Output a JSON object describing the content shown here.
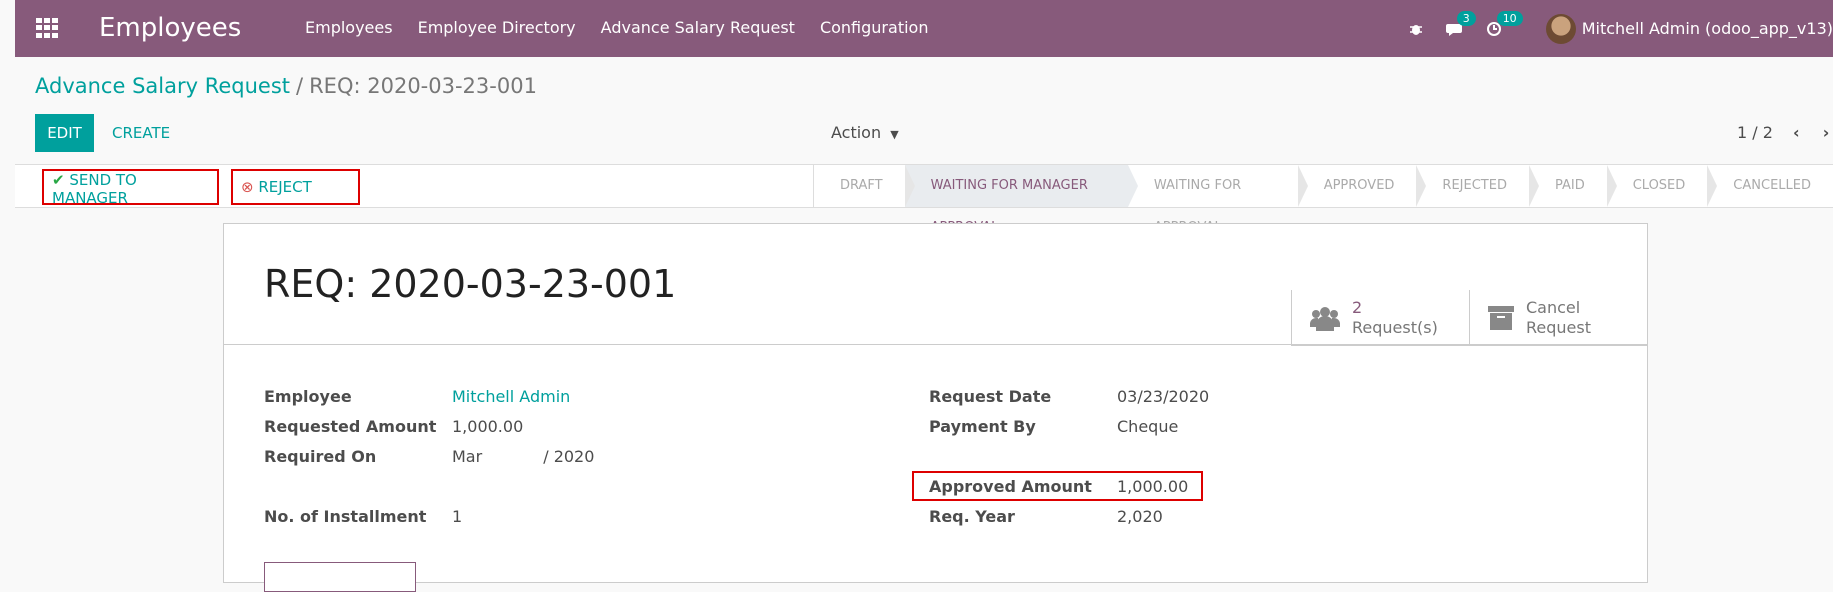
{
  "app": {
    "title": "Employees",
    "menu": [
      "Employees",
      "Employee Directory",
      "Advance Salary Request",
      "Configuration"
    ],
    "chat_badge": "3",
    "activity_badge": "10",
    "user": "Mitchell Admin (odoo_app_v13)"
  },
  "breadcrumb": {
    "parent": "Advance Salary Request",
    "separator": "/",
    "current": "REQ: 2020-03-23-001"
  },
  "control": {
    "edit": "EDIT",
    "create": "CREATE",
    "action": "Action",
    "pager": "1 / 2"
  },
  "statusbar": {
    "send_to_manager": "SEND TO MANAGER",
    "reject": "REJECT",
    "stages": [
      "DRAFT",
      "WAITING FOR MANAGER APPROVAL",
      "WAITING FOR APPROVAL",
      "APPROVED",
      "REJECTED",
      "PAID",
      "CLOSED",
      "CANCELLED"
    ],
    "active_stage": "WAITING FOR MANAGER APPROVAL"
  },
  "form": {
    "title": "REQ: 2020-03-23-001",
    "smart": {
      "requests_count": "2",
      "requests_label": "Request(s)",
      "cancel_line1": "Cancel",
      "cancel_line2": "Request"
    },
    "left": {
      "employee_label": "Employee",
      "employee_value": "Mitchell Admin",
      "requested_amount_label": "Requested Amount",
      "requested_amount_value": "1,000.00",
      "required_on_label": "Required On",
      "required_on_value": "Mar            / 2020",
      "installment_label": "No. of Installment",
      "installment_value": "1"
    },
    "right": {
      "request_date_label": "Request Date",
      "request_date_value": "03/23/2020",
      "payment_by_label": "Payment By",
      "payment_by_value": "Cheque",
      "approved_amount_label": "Approved Amount",
      "approved_amount_value": "1,000.00",
      "req_year_label": "Req. Year",
      "req_year_value": "2,020"
    }
  }
}
